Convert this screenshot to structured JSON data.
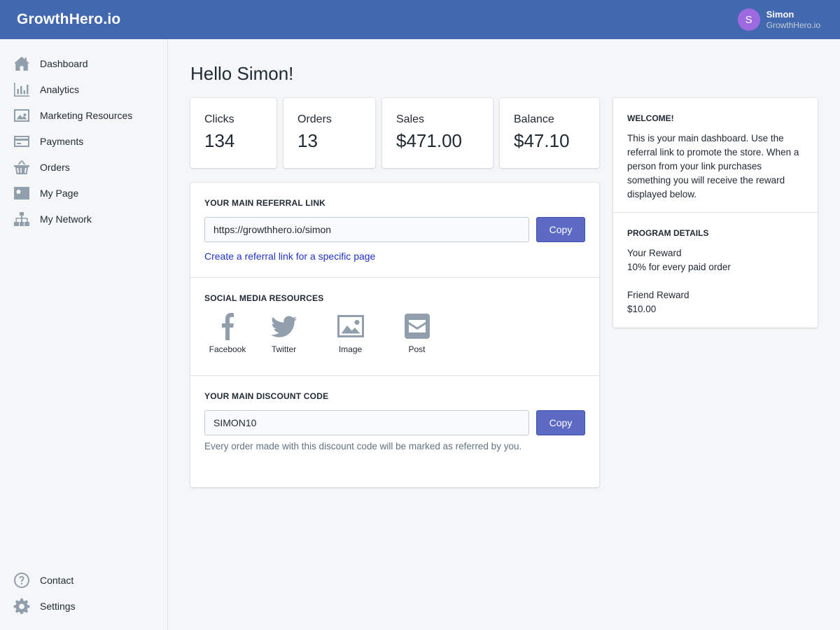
{
  "header": {
    "brand": "GrowthHero.io",
    "user": {
      "initial": "S",
      "name": "Simon",
      "store": "GrowthHero.io"
    },
    "avatar_color": "#9c6ade",
    "bar_color": "#4268b0"
  },
  "sidebar": {
    "items": [
      {
        "label": "Dashboard",
        "icon": "home-icon"
      },
      {
        "label": "Analytics",
        "icon": "bar-chart-icon"
      },
      {
        "label": "Marketing Resources",
        "icon": "image-icon"
      },
      {
        "label": "Payments",
        "icon": "credit-card-icon"
      },
      {
        "label": "Orders",
        "icon": "basket-icon"
      },
      {
        "label": "My Page",
        "icon": "profile-card-icon"
      },
      {
        "label": "My Network",
        "icon": "network-icon"
      }
    ],
    "bottom_items": [
      {
        "label": "Contact",
        "icon": "question-icon"
      },
      {
        "label": "Settings",
        "icon": "gear-icon"
      }
    ]
  },
  "main": {
    "title": "Hello Simon!",
    "stats": [
      {
        "label": "Clicks",
        "value": "134"
      },
      {
        "label": "Orders",
        "value": "13"
      },
      {
        "label": "Sales",
        "value": "$471.00"
      },
      {
        "label": "Balance",
        "value": "$47.10"
      }
    ],
    "referral": {
      "title": "YOUR MAIN REFERRAL LINK",
      "value": "https://growthhero.io/simon",
      "button": "Copy",
      "link": "Create a referral link for a specific page"
    },
    "social": {
      "title": "SOCIAL MEDIA RESOURCES",
      "items": [
        {
          "label": "Facebook",
          "icon": "facebook-icon"
        },
        {
          "label": "Twitter",
          "icon": "twitter-icon"
        },
        {
          "label": "Image",
          "icon": "image-icon"
        },
        {
          "label": "Post",
          "icon": "envelope-icon"
        }
      ]
    },
    "discount": {
      "title": "YOUR MAIN DISCOUNT CODE",
      "value": "SIMON10",
      "button": "Copy",
      "help": "Every order made with this discount code will be marked as referred by you."
    }
  },
  "aside": {
    "welcome_title": "WELCOME!",
    "welcome_text": "This is your main dashboard. Use the referral link to promote the store. When a person from your link purchases something you will receive the reward displayed below.",
    "program_title": "PROGRAM DETAILS",
    "your_reward_label": "Your Reward",
    "your_reward_value": "10% for every paid order",
    "friend_reward_label": "Friend Reward",
    "friend_reward_value": "$10.00"
  },
  "accent_color": "#5c6ac4"
}
